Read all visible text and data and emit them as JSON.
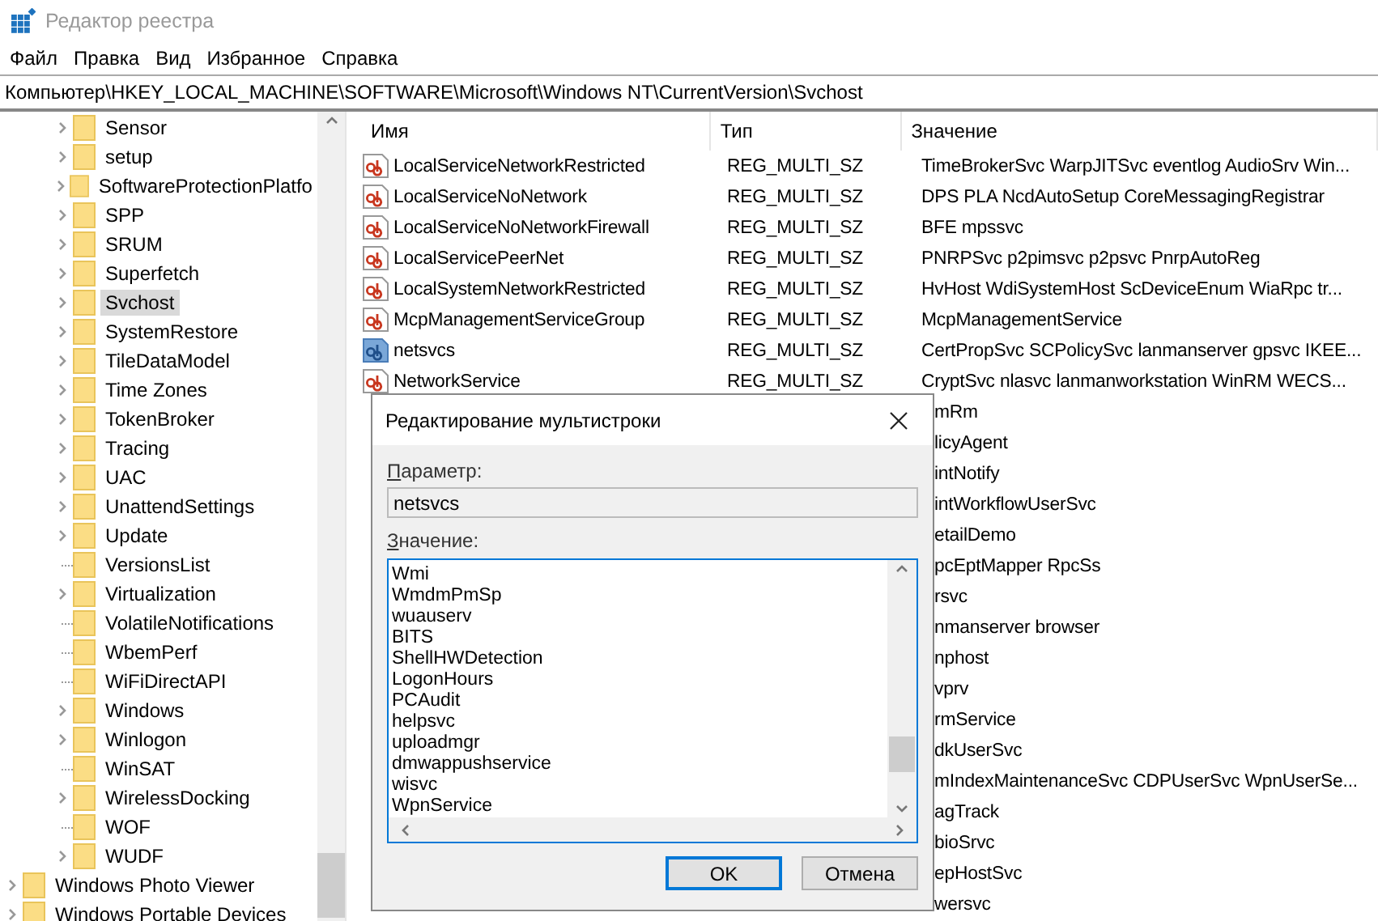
{
  "window": {
    "title": "Редактор реестра"
  },
  "menu": [
    "Файл",
    "Правка",
    "Вид",
    "Избранное",
    "Справка"
  ],
  "address": "Компьютер\\HKEY_LOCAL_MACHINE\\SOFTWARE\\Microsoft\\Windows NT\\CurrentVersion\\Svchost",
  "tree": {
    "scrolled_branch": [
      {
        "label": "Sensor",
        "has_children": true,
        "selected": false
      },
      {
        "label": "setup",
        "has_children": true,
        "selected": false
      },
      {
        "label": "SoftwareProtectionPlatfo",
        "has_children": true,
        "selected": false
      },
      {
        "label": "SPP",
        "has_children": true,
        "selected": false
      },
      {
        "label": "SRUM",
        "has_children": true,
        "selected": false
      },
      {
        "label": "Superfetch",
        "has_children": true,
        "selected": false
      },
      {
        "label": "Svchost",
        "has_children": true,
        "selected": true
      },
      {
        "label": "SystemRestore",
        "has_children": true,
        "selected": false
      },
      {
        "label": "TileDataModel",
        "has_children": true,
        "selected": false
      },
      {
        "label": "Time Zones",
        "has_children": true,
        "selected": false
      },
      {
        "label": "TokenBroker",
        "has_children": true,
        "selected": false
      },
      {
        "label": "Tracing",
        "has_children": true,
        "selected": false
      },
      {
        "label": "UAC",
        "has_children": true,
        "selected": false
      },
      {
        "label": "UnattendSettings",
        "has_children": true,
        "selected": false
      },
      {
        "label": "Update",
        "has_children": true,
        "selected": false
      },
      {
        "label": "VersionsList",
        "has_children": false,
        "selected": false
      },
      {
        "label": "Virtualization",
        "has_children": true,
        "selected": false
      },
      {
        "label": "VolatileNotifications",
        "has_children": false,
        "selected": false
      },
      {
        "label": "WbemPerf",
        "has_children": false,
        "selected": false
      },
      {
        "label": "WiFiDirectAPI",
        "has_children": false,
        "selected": false
      },
      {
        "label": "Windows",
        "has_children": true,
        "selected": false
      },
      {
        "label": "Winlogon",
        "has_children": true,
        "selected": false
      },
      {
        "label": "WinSAT",
        "has_children": false,
        "selected": false
      },
      {
        "label": "WirelessDocking",
        "has_children": true,
        "selected": false
      },
      {
        "label": "WOF",
        "has_children": false,
        "selected": false
      },
      {
        "label": "WUDF",
        "has_children": true,
        "selected": false
      }
    ],
    "items": [
      {
        "label": "Windows Photo Viewer",
        "has_children": true,
        "selected": false
      },
      {
        "label": "Windows Portable Devices",
        "has_children": true,
        "selected": false
      }
    ]
  },
  "table": {
    "columns": [
      "Имя",
      "Тип",
      "Значение"
    ],
    "rows": [
      {
        "name": "LocalServiceNetworkRestricted",
        "type": "REG_MULTI_SZ",
        "value": "TimeBrokerSvc WarpJITSvc eventlog AudioSrv Win...",
        "selected": false
      },
      {
        "name": "LocalServiceNoNetwork",
        "type": "REG_MULTI_SZ",
        "value": "DPS PLA NcdAutoSetup CoreMessagingRegistrar",
        "selected": false
      },
      {
        "name": "LocalServiceNoNetworkFirewall",
        "type": "REG_MULTI_SZ",
        "value": "BFE mpssvc",
        "selected": false
      },
      {
        "name": "LocalServicePeerNet",
        "type": "REG_MULTI_SZ",
        "value": "PNRPSvc p2pimsvc p2psvc PnrpAutoReg",
        "selected": false
      },
      {
        "name": "LocalSystemNetworkRestricted",
        "type": "REG_MULTI_SZ",
        "value": "HvHost WdiSystemHost ScDeviceEnum WiaRpc tr...",
        "selected": false
      },
      {
        "name": "McpManagementServiceGroup",
        "type": "REG_MULTI_SZ",
        "value": "McpManagementService",
        "selected": false
      },
      {
        "name": "netsvcs",
        "type": "REG_MULTI_SZ",
        "value": "CertPropSvc SCPolicySvc lanmanserver gpsvc IKEE...",
        "selected": true
      },
      {
        "name": "NetworkService",
        "type": "REG_MULTI_SZ",
        "value": "CryptSvc nlasvc lanmanworkstation WinRM WECS...",
        "selected": false
      },
      {
        "value": "mRm"
      },
      {
        "value": "licyAgent"
      },
      {
        "value": "intNotify"
      },
      {
        "value": "intWorkflowUserSvc"
      },
      {
        "value": "etailDemo"
      },
      {
        "value": "pcEptMapper RpcSs"
      },
      {
        "value": "rsvc"
      },
      {
        "value": "nmanserver browser"
      },
      {
        "value": "nphost"
      },
      {
        "value": "vprv"
      },
      {
        "value": "rmService"
      },
      {
        "value": "dkUserSvc"
      },
      {
        "value": "mIndexMaintenanceSvc CDPUserSvc WpnUserSe..."
      },
      {
        "value": "agTrack"
      },
      {
        "value": "bioSrvc"
      },
      {
        "value": "epHostSvc"
      },
      {
        "value": "wersvc"
      }
    ]
  },
  "dialog": {
    "title": "Редактирование мультистроки",
    "name_label": "Параметр:",
    "name_value": "netsvcs",
    "data_label": "Значение:",
    "data_lines": [
      "Wmi",
      "WmdmPmSp",
      "wuauserv",
      "BITS",
      "ShellHWDetection",
      "LogonHours",
      "PCAudit",
      "helpsvc",
      "uploadmgr",
      "dmwappushservice",
      "wisvc",
      "WpnService"
    ],
    "buttons": [
      {
        "label": "OK",
        "default": true
      },
      {
        "label": "Отмена",
        "default": false
      }
    ]
  }
}
